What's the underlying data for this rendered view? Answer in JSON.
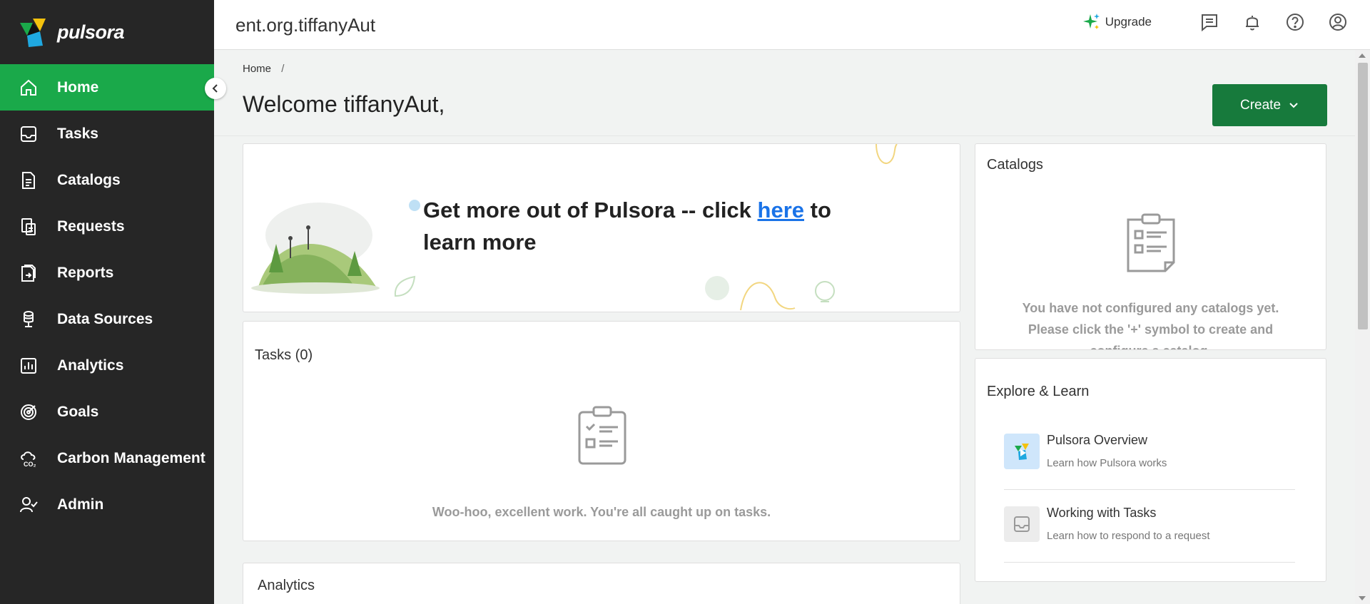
{
  "app": {
    "name": "pulsora",
    "org": "ent.org.tiffanyAut"
  },
  "sidebar": {
    "items": [
      {
        "label": "Home",
        "icon": "home-icon",
        "active": true
      },
      {
        "label": "Tasks",
        "icon": "inbox-icon"
      },
      {
        "label": "Catalogs",
        "icon": "document-icon"
      },
      {
        "label": "Requests",
        "icon": "requests-icon"
      },
      {
        "label": "Reports",
        "icon": "report-export-icon"
      },
      {
        "label": "Data Sources",
        "icon": "database-icon"
      },
      {
        "label": "Analytics",
        "icon": "bar-chart-icon"
      },
      {
        "label": "Goals",
        "icon": "target-icon"
      },
      {
        "label": "Carbon Management",
        "icon": "co2-cloud-icon"
      },
      {
        "label": "Admin",
        "icon": "user-check-icon"
      }
    ]
  },
  "header": {
    "upgrade_label": "Upgrade"
  },
  "page": {
    "breadcrumb": "Home",
    "breadcrumb_sep": "/",
    "title": "Welcome tiffanyAut,",
    "create_label": "Create"
  },
  "banner": {
    "text_before": "Get more out of Pulsora -- click ",
    "link_text": "here",
    "text_after": " to learn more"
  },
  "tasks": {
    "title": "Tasks (0)",
    "empty_message": "Woo-hoo, excellent work. You're all caught up on tasks."
  },
  "catalogs": {
    "title": "Catalogs",
    "empty_message": "You have not configured any catalogs yet. Please click the '+' symbol to create and configure a catalog."
  },
  "explore": {
    "title": "Explore & Learn",
    "items": [
      {
        "title": "Pulsora Overview",
        "subtitle": "Learn how Pulsora works"
      },
      {
        "title": "Working with Tasks",
        "subtitle": "Learn how to respond to a request"
      }
    ]
  },
  "analytics": {
    "title": "Analytics"
  },
  "colors": {
    "sidebar_bg": "#262626",
    "active_green": "#1aa94a",
    "create_button": "#177a3c",
    "link_blue": "#1a73e8"
  }
}
